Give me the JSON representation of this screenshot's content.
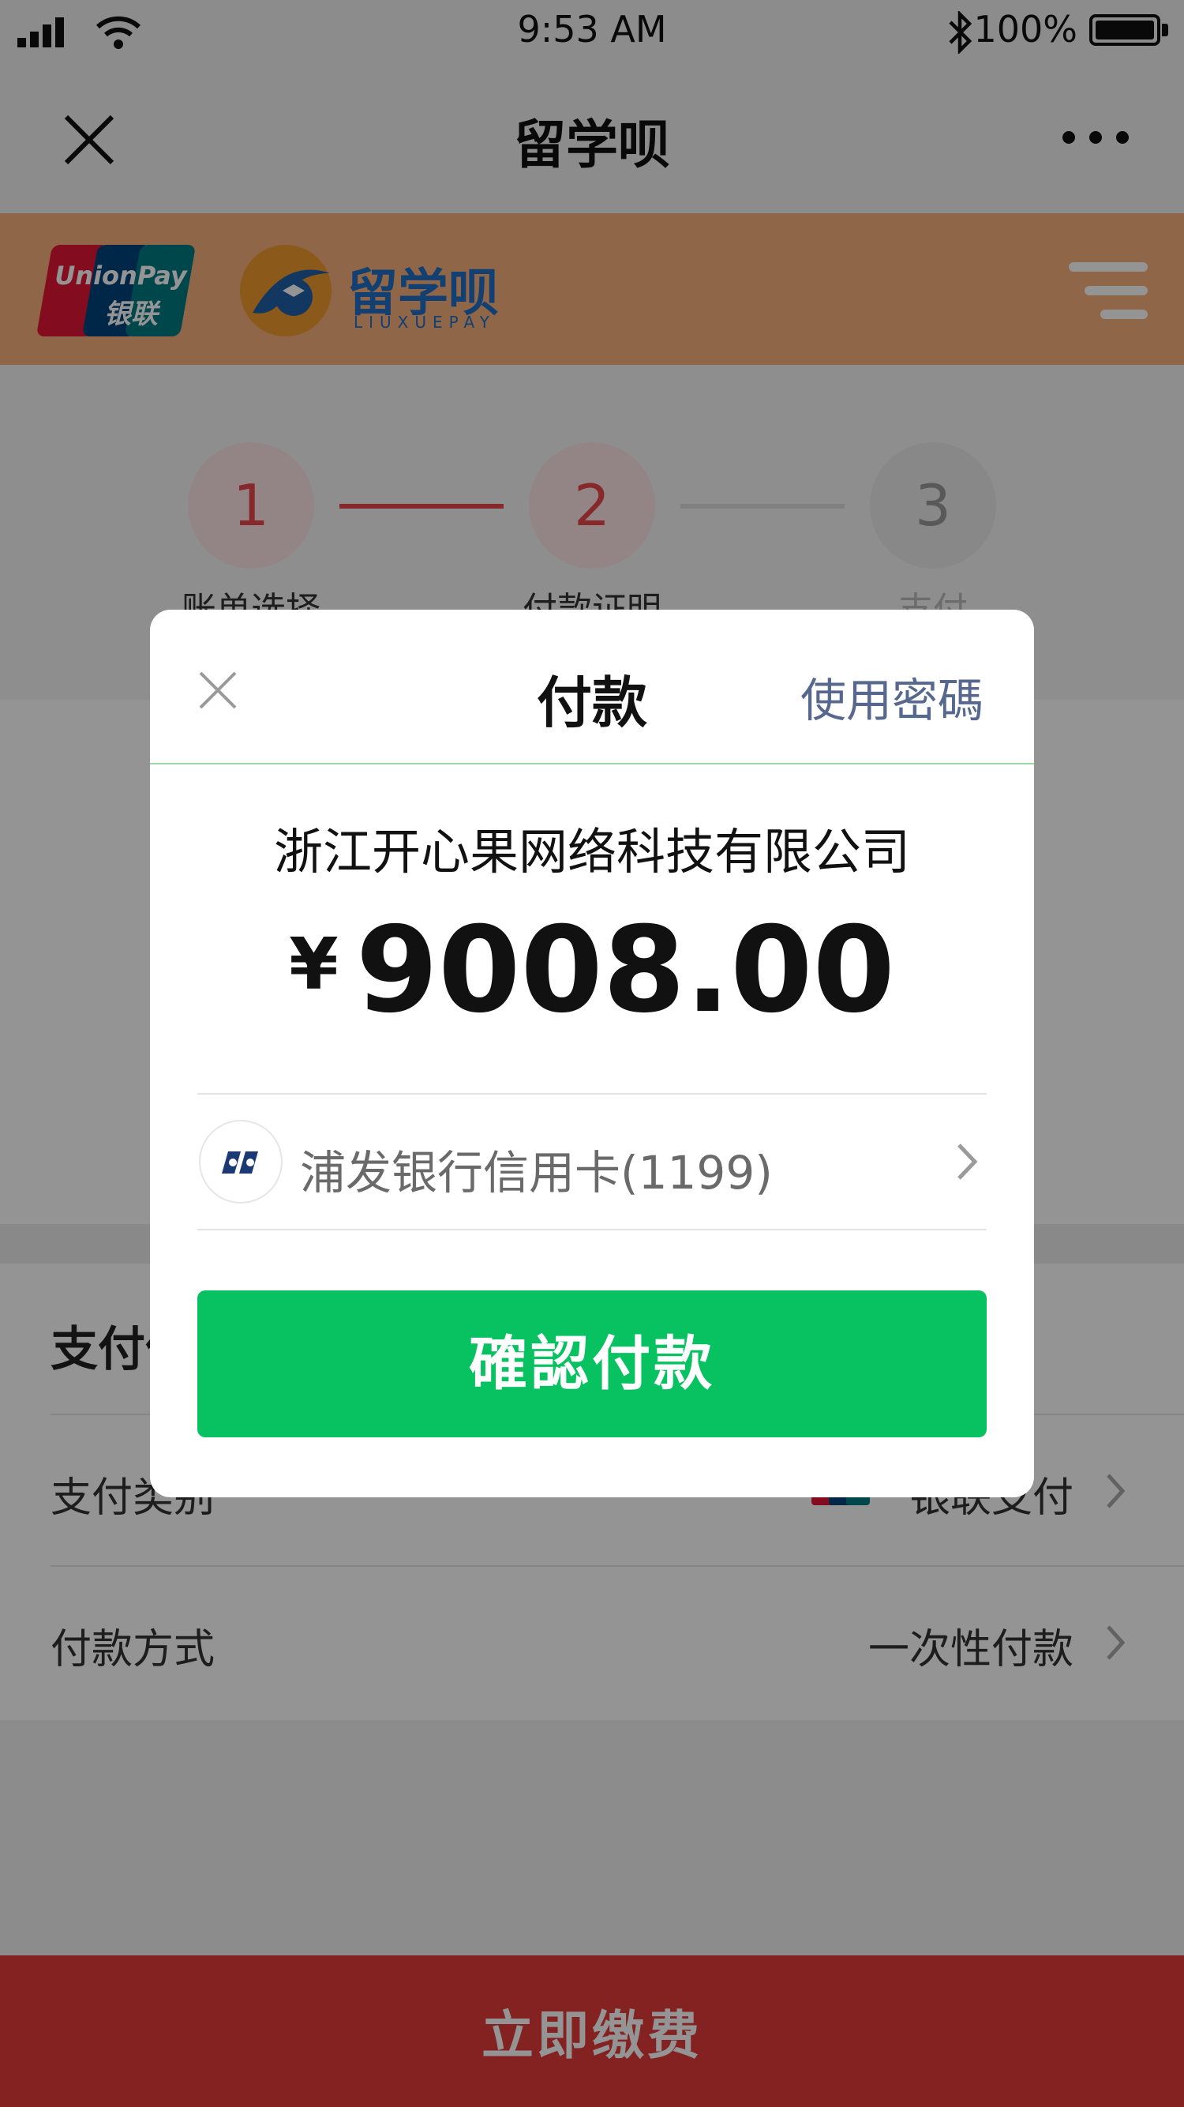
{
  "status_bar": {
    "time": "9:53 AM",
    "battery": "100%"
  },
  "nav": {
    "title": "留学呗"
  },
  "brand": {
    "unionpay_text_en": "UnionPay",
    "unionpay_text_cn": "银联",
    "logo_text_cn": "留学呗",
    "logo_text_en": "LIUXUEPAY"
  },
  "steps": [
    {
      "number": "1",
      "label": "账单选择"
    },
    {
      "number": "2",
      "label": "付款证明"
    },
    {
      "number": "3",
      "label": "支付"
    }
  ],
  "payment_section": {
    "title": "支付信息",
    "rows": [
      {
        "label": "支付类别",
        "value": "银联支付"
      },
      {
        "label": "付款方式",
        "value": "一次性付款"
      }
    ]
  },
  "footer": {
    "pay_now_label": "立即缴费"
  },
  "modal": {
    "title": "付款",
    "use_password_label": "使用密碼",
    "merchant": "浙江开心果网络科技有限公司",
    "currency_symbol": "¥",
    "amount": "9008.00",
    "card_name": "浦发银行信用卡(1199)",
    "confirm_label": "確認付款"
  },
  "colors": {
    "overlay": "rgba(0,0,0,0.42)",
    "confirm_green": "#08c160",
    "brand_orange": "#f7b07c",
    "footer_red": "#e43a3a",
    "step_red": "#e8454a",
    "link_blue": "#57688f"
  }
}
